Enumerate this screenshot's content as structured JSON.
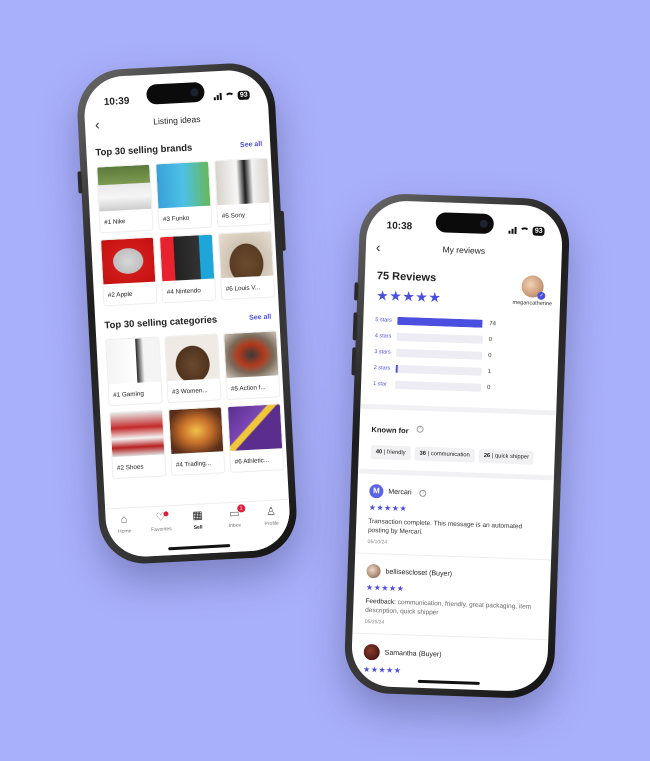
{
  "phone_left": {
    "status": {
      "time": "10:39",
      "battery": "93"
    },
    "nav": {
      "title": "Listing ideas"
    },
    "brands": {
      "title": "Top 30 selling brands",
      "see_all": "See all",
      "items": [
        {
          "label": "#1  Nike"
        },
        {
          "label": "#3  Funko"
        },
        {
          "label": "#5  Sony"
        },
        {
          "label": "#2  Apple"
        },
        {
          "label": "#4  Nintendo"
        },
        {
          "label": "#6  Louis V..."
        }
      ]
    },
    "categories": {
      "title": "Top 30 selling categories",
      "see_all": "See all",
      "items": [
        {
          "label": "#1  Gaming"
        },
        {
          "label": "#3  Women..."
        },
        {
          "label": "#5  Action f..."
        },
        {
          "label": "#2  Shoes"
        },
        {
          "label": "#4  Trading..."
        },
        {
          "label": "#6  Athletic..."
        }
      ]
    },
    "tabs": [
      {
        "label": "Home",
        "icon": "home-icon"
      },
      {
        "label": "Favorites",
        "icon": "heart-icon"
      },
      {
        "label": "Sell",
        "icon": "store-icon"
      },
      {
        "label": "Inbox",
        "icon": "chat-icon",
        "badge": "1"
      },
      {
        "label": "Profile",
        "icon": "person-icon"
      }
    ]
  },
  "phone_right": {
    "status": {
      "time": "10:38",
      "battery": "93"
    },
    "nav": {
      "title": "My reviews"
    },
    "summary": {
      "count_label": "75 Reviews",
      "stars": "★★★★★",
      "username": "megancatherine"
    },
    "ratings": [
      {
        "label": "5 stars",
        "count": "74",
        "fraction": 0.99
      },
      {
        "label": "4 stars",
        "count": "0",
        "fraction": 0
      },
      {
        "label": "3 stars",
        "count": "0",
        "fraction": 0
      },
      {
        "label": "2 stars",
        "count": "1",
        "fraction": 0.02
      },
      {
        "label": "1 star",
        "count": "0",
        "fraction": 0
      }
    ],
    "known_for": {
      "title": "Known for",
      "chips": [
        {
          "num": "40",
          "text": "friendly"
        },
        {
          "num": "36",
          "text": "communication"
        },
        {
          "num": "26",
          "text": "quick shipper"
        }
      ]
    },
    "reviews": [
      {
        "name": "Mercari",
        "stars": "★★★★★",
        "text": "Transaction complete. This message is an automated posting by Mercari.",
        "date": "06/10/24"
      },
      {
        "name": "bellisescloset (Buyer)",
        "stars": "★★★★★",
        "feedback_label": "Feedback:",
        "text": "communication, friendly, great packaging, item description, quick shipper",
        "date": "05/25/24"
      },
      {
        "name": "Samantha (Buyer)",
        "stars": "★★★★★"
      }
    ],
    "accent": "#4b4fe0"
  }
}
